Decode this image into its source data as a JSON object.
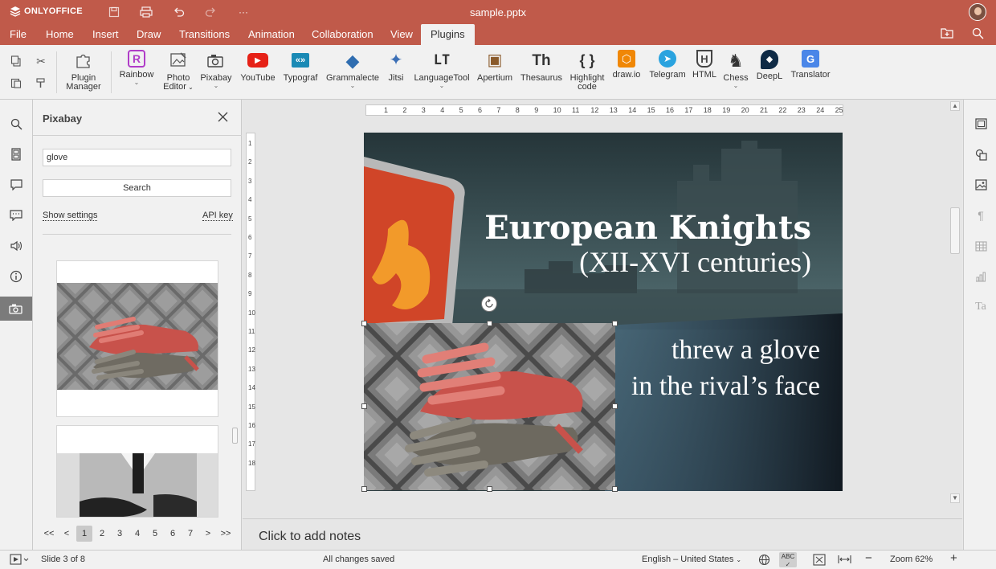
{
  "app": {
    "name": "ONLYOFFICE",
    "document_title": "sample.pptx"
  },
  "titlebar": {
    "icons": [
      "save-icon",
      "print-icon",
      "undo-icon",
      "redo-icon",
      "more-icon"
    ],
    "more_glyph": "···"
  },
  "menu": {
    "tabs": [
      "File",
      "Home",
      "Insert",
      "Draw",
      "Transitions",
      "Animation",
      "Collaboration",
      "View",
      "Plugins"
    ],
    "active": "Plugins"
  },
  "ribbon": {
    "plugin_manager": "Plugin Manager",
    "plugin_manager_line1": "Plugin",
    "plugin_manager_line2": "Manager",
    "plugins": [
      {
        "label": "Rainbow",
        "icon": "rainbow-icon",
        "glyph": "R",
        "color": "#b03cc8",
        "dropdown": true
      },
      {
        "label": "Photo Editor",
        "label1": "Photo",
        "label2": "Editor",
        "icon": "photo-editor-icon",
        "glyph": "✎",
        "color": "#555555",
        "dropdown": true
      },
      {
        "label": "Pixabay",
        "icon": "pixabay-icon",
        "glyph": "📷",
        "color": "#444444",
        "dropdown": true
      },
      {
        "label": "YouTube",
        "icon": "youtube-icon",
        "glyph": "▶",
        "color": "#e62117"
      },
      {
        "label": "Typograf",
        "icon": "typograf-icon",
        "glyph": "«»",
        "color": "#1a8ab5"
      },
      {
        "label": "Grammalecte",
        "icon": "grammalecte-icon",
        "glyph": "◆",
        "color": "#2f6db0",
        "dropdown": true
      },
      {
        "label": "Jitsi",
        "icon": "jitsi-icon",
        "glyph": "✦",
        "color": "#3b6fb6"
      },
      {
        "label": "LanguageTool",
        "icon": "languagetool-icon",
        "glyph": "LT",
        "color": "#333333",
        "dropdown": true
      },
      {
        "label": "Apertium",
        "icon": "apertium-icon",
        "glyph": "▣",
        "color": "#8a5a2b"
      },
      {
        "label": "Thesaurus",
        "icon": "thesaurus-icon",
        "glyph": "Th",
        "color": "#333333"
      },
      {
        "label": "Highlight code",
        "label1": "Highlight",
        "label2": "code",
        "icon": "highlight-code-icon",
        "glyph": "{ }",
        "color": "#333333"
      },
      {
        "label": "draw.io",
        "icon": "drawio-icon",
        "glyph": "⬡",
        "color": "#f08705"
      },
      {
        "label": "Telegram",
        "icon": "telegram-icon",
        "glyph": "➤",
        "color": "#2aa3df"
      },
      {
        "label": "HTML",
        "icon": "html-icon",
        "glyph": "H",
        "color": "#444444"
      },
      {
        "label": "Chess",
        "icon": "chess-icon",
        "glyph": "♞",
        "color": "#333333",
        "dropdown": true
      },
      {
        "label": "DeepL",
        "icon": "deepl-icon",
        "glyph": "◆",
        "color": "#0f2b46"
      },
      {
        "label": "Translator",
        "icon": "translator-icon",
        "glyph": "G",
        "color": "#4a86e8"
      }
    ]
  },
  "panel": {
    "title": "Pixabay",
    "search_value": "glove",
    "search_button": "Search",
    "show_settings": "Show settings",
    "api_key": "API key",
    "pager": [
      "<<",
      "<",
      "1",
      "2",
      "3",
      "4",
      "5",
      "6",
      "7",
      ">",
      ">>"
    ],
    "current_page": "1"
  },
  "ruler": {
    "h_ticks": [
      "1",
      "2",
      "3",
      "4",
      "5",
      "6",
      "7",
      "8",
      "9",
      "10",
      "11",
      "12",
      "13",
      "14",
      "15",
      "16",
      "17",
      "18",
      "19",
      "20",
      "21",
      "22",
      "23",
      "24",
      "25"
    ],
    "v_ticks": [
      "1",
      "2",
      "3",
      "4",
      "5",
      "6",
      "7",
      "8",
      "9",
      "10",
      "11",
      "12",
      "13",
      "14",
      "15",
      "16",
      "17",
      "18"
    ]
  },
  "slide": {
    "title": "European Knights",
    "subtitle": "(XII-XVI centuries)",
    "line1": "threw a glove",
    "line2": "in the rival’s face"
  },
  "notes": {
    "placeholder": "Click to add notes"
  },
  "status": {
    "slide_info": "Slide 3 of 8",
    "saved": "All changes saved",
    "language": "English – United States",
    "zoom": "Zoom 62%"
  }
}
